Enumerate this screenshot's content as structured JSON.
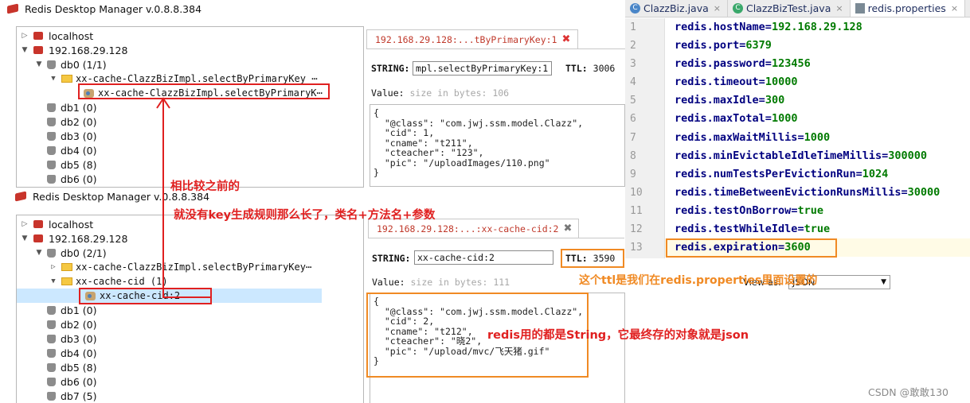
{
  "window1": {
    "title": "Redis Desktop Manager v.0.8.8.384",
    "tree": {
      "localhost": "localhost",
      "server": "192.168.29.128",
      "db0": "db0  (1/1)",
      "folder": "xx-cache-ClazzBizImpl.selectByPrimaryKey ⋯",
      "key": "xx-cache-ClazzBizImpl.selectByPrimaryK⋯",
      "dbs": [
        "db1 (0)",
        "db2 (0)",
        "db3 (0)",
        "db4 (0)",
        "db5 (8)",
        "db6 (0)"
      ]
    },
    "tab": {
      "label": "192.168.29.128:...tByPrimaryKey:1",
      "close": "✖"
    },
    "type_label": "STRING:",
    "key_value": "mpl.selectByPrimaryKey:1",
    "ttl_label": "TTL:",
    "ttl_value": "3006",
    "value_label": "Value:",
    "size_label": "size in bytes: 106",
    "json": "{\n  \"@class\": \"com.jwj.ssm.model.Clazz\",\n  \"cid\": 1,\n  \"cname\": \"t211\",\n  \"cteacher\": \"123\",\n  \"pic\": \"/uploadImages/110.png\"\n}"
  },
  "window2": {
    "title": "Redis Desktop Manager v.0.8.8.384",
    "tree": {
      "localhost": "localhost",
      "server": "192.168.29.128",
      "db0": "db0  (2/1)",
      "folder1": "xx-cache-ClazzBizImpl.selectByPrimaryKey⋯",
      "folder2": "xx-cache-cid (1)",
      "key": "xx-cache-cid:2",
      "dbs": [
        "db1 (0)",
        "db2 (0)",
        "db3 (0)",
        "db4 (0)",
        "db5 (8)",
        "db6 (0)",
        "db7 (5)"
      ]
    },
    "tab": {
      "label": "192.168.29.128:...:xx-cache-cid:2",
      "close": "✖"
    },
    "type_label": "STRING:",
    "key_value": "xx-cache-cid:2",
    "ttl_label": "TTL:",
    "ttl_value": "3590",
    "value_label": "Value:",
    "size_label": "size in bytes: 111",
    "view_as_label": "View as:",
    "view_as_value": "JSON",
    "json": "{\n  \"@class\": \"com.jwj.ssm.model.Clazz\",\n  \"cid\": 2,\n  \"cname\": \"t212\",\n  \"cteacher\": \"晓2\",\n  \"pic\": \"/upload/mvc/飞天猪.gif\"\n}"
  },
  "ide": {
    "tabs": [
      {
        "label": "ClazzBiz.java",
        "close": "×"
      },
      {
        "label": "ClazzBizTest.java",
        "close": "×"
      },
      {
        "label": "redis.properties",
        "close": "×"
      }
    ],
    "lines": [
      {
        "n": "1",
        "k": "redis.hostName",
        "v": "192.168.29.128"
      },
      {
        "n": "2",
        "k": "redis.port",
        "v": "6379"
      },
      {
        "n": "3",
        "k": "redis.password",
        "v": "123456"
      },
      {
        "n": "4",
        "k": "redis.timeout",
        "v": "10000"
      },
      {
        "n": "5",
        "k": "redis.maxIdle",
        "v": "300"
      },
      {
        "n": "6",
        "k": "redis.maxTotal",
        "v": "1000"
      },
      {
        "n": "7",
        "k": "redis.maxWaitMillis",
        "v": "1000"
      },
      {
        "n": "8",
        "k": "redis.minEvictableIdleTimeMillis",
        "v": "300000"
      },
      {
        "n": "9",
        "k": "redis.numTestsPerEvictionRun",
        "v": "1024"
      },
      {
        "n": "10",
        "k": "redis.timeBetweenEvictionRunsMillis",
        "v": "30000"
      },
      {
        "n": "11",
        "k": "redis.testOnBorrow",
        "v": "true"
      },
      {
        "n": "12",
        "k": "redis.testWhileIdle",
        "v": "true"
      },
      {
        "n": "13",
        "k": "redis.expiration",
        "v": "3600"
      }
    ]
  },
  "annotations": {
    "compare": "相比较之前的",
    "no_long_key": "就没有key生成规则那么长了，类名+方法名+参数",
    "ttl_note": "这个ttl是我们在redis.properties里面设置的",
    "json_note": "redis用的都是String，它最终存的对象就是json"
  },
  "watermark": "CSDN @敢敢130",
  "colors": {
    "annotation_red": "#e02020",
    "annotation_orange": "#f08a24",
    "redis_red": "#c8342b"
  }
}
